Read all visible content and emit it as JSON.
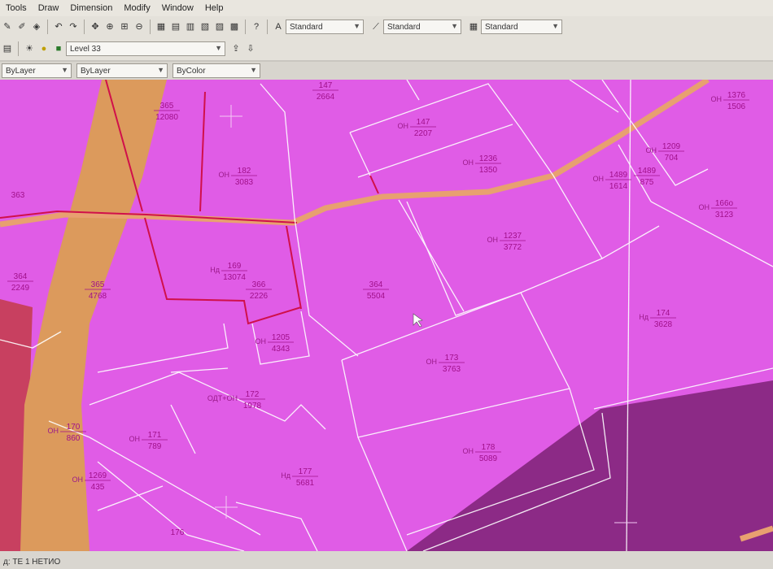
{
  "menu": [
    "Tools",
    "Draw",
    "Dimension",
    "Modify",
    "Window",
    "Help"
  ],
  "toolbar": {
    "text_style": "Standard",
    "dim_style": "Standard",
    "table_style": "Standard"
  },
  "layers": {
    "current_layer": "Level 33",
    "color": "ByLayer",
    "linetype": "ByLayer",
    "lineweight": "ByColor"
  },
  "parcels": [
    {
      "prefix": "",
      "id": "147",
      "area": "2664"
    },
    {
      "prefix": "ОН",
      "id": "147",
      "area": "2207"
    },
    {
      "prefix": "ОН",
      "id": "1236",
      "area": "1350"
    },
    {
      "prefix": "ОН",
      "id": "182",
      "area": "3083"
    },
    {
      "prefix": "",
      "id": "365",
      "area": "12080"
    },
    {
      "prefix": "",
      "id": "363",
      "area": ""
    },
    {
      "prefix": "",
      "id": "364",
      "area": "2249"
    },
    {
      "prefix": "",
      "id": "365",
      "area": "4768"
    },
    {
      "prefix": "Нд",
      "id": "169",
      "area": "13074"
    },
    {
      "prefix": "",
      "id": "366",
      "area": "2226"
    },
    {
      "prefix": "",
      "id": "364",
      "area": "5504"
    },
    {
      "prefix": "ОН",
      "id": "1237",
      "area": "3772"
    },
    {
      "prefix": "ОН",
      "id": "1205",
      "area": "4343"
    },
    {
      "prefix": "ОН",
      "id": "173",
      "area": "3763"
    },
    {
      "prefix": "Нд",
      "id": "174",
      "area": "3628"
    },
    {
      "prefix": "ОН",
      "id": "166o",
      "area": "3123"
    },
    {
      "prefix": "ОН",
      "id": "1489",
      "area": "1614"
    },
    {
      "prefix": "",
      "id": "1489",
      "area": "875"
    },
    {
      "prefix": "ОН",
      "id": "1209",
      "area": "704"
    },
    {
      "prefix": "ОН",
      "id": "1376",
      "area": "1506"
    },
    {
      "prefix": "ОДТ+ОН",
      "id": "172",
      "area": "1978"
    },
    {
      "prefix": "ОН",
      "id": "170",
      "area": "860"
    },
    {
      "prefix": "ОН",
      "id": "171",
      "area": "789"
    },
    {
      "prefix": "ОН",
      "id": "178",
      "area": "5089"
    },
    {
      "prefix": "Нд",
      "id": "177",
      "area": "5681"
    },
    {
      "prefix": "ОН",
      "id": "1269",
      "area": "435"
    },
    {
      "prefix": "",
      "id": "176",
      "area": ""
    }
  ],
  "command_line": "д: ТЕ 1 НЕТИО",
  "colors": {
    "zone_main": "#e05ce6",
    "zone_dark": "#8c2a86",
    "corridor": "#dc9a5c",
    "red_zone": "#c84060",
    "road": "#e8a070"
  }
}
